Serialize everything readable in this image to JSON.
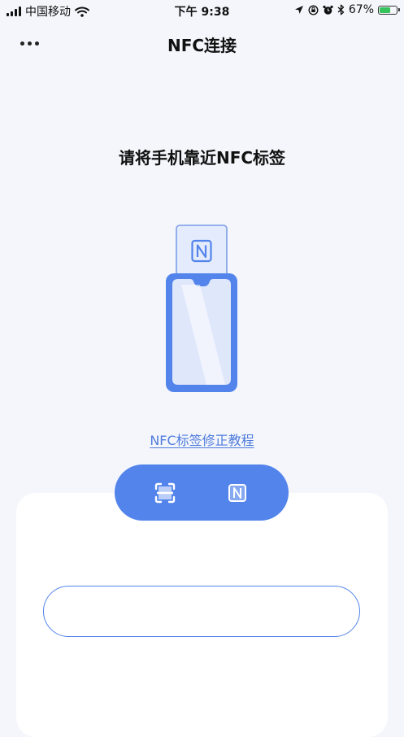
{
  "status_bar": {
    "carrier": "中国移动",
    "time": "下午 9:38",
    "battery_percent": "67%",
    "battery_level": 0.67,
    "icons": [
      "signal-icon",
      "wifi-icon",
      "location-arrow-icon",
      "rotation-lock-icon",
      "alarm-icon",
      "bluetooth-icon",
      "battery-icon"
    ]
  },
  "nav": {
    "title": "NFC连接",
    "more_icon": "more-dots-icon"
  },
  "main": {
    "instruction": "请将手机靠近NFC标签",
    "illustration_icon": "phone-nfc-tag-icon",
    "tutorial_link": "NFC标签修正教程"
  },
  "mode_switch": {
    "scan_icon": "scan-icon",
    "nfc_icon": "nfc-icon",
    "active": "nfc"
  },
  "input": {
    "value": "",
    "placeholder": ""
  },
  "colors": {
    "accent": "#5384eb",
    "link": "#4f7cdc",
    "background": "#f4f6fb",
    "card": "#ffffff",
    "battery_fill": "#37c35b"
  }
}
